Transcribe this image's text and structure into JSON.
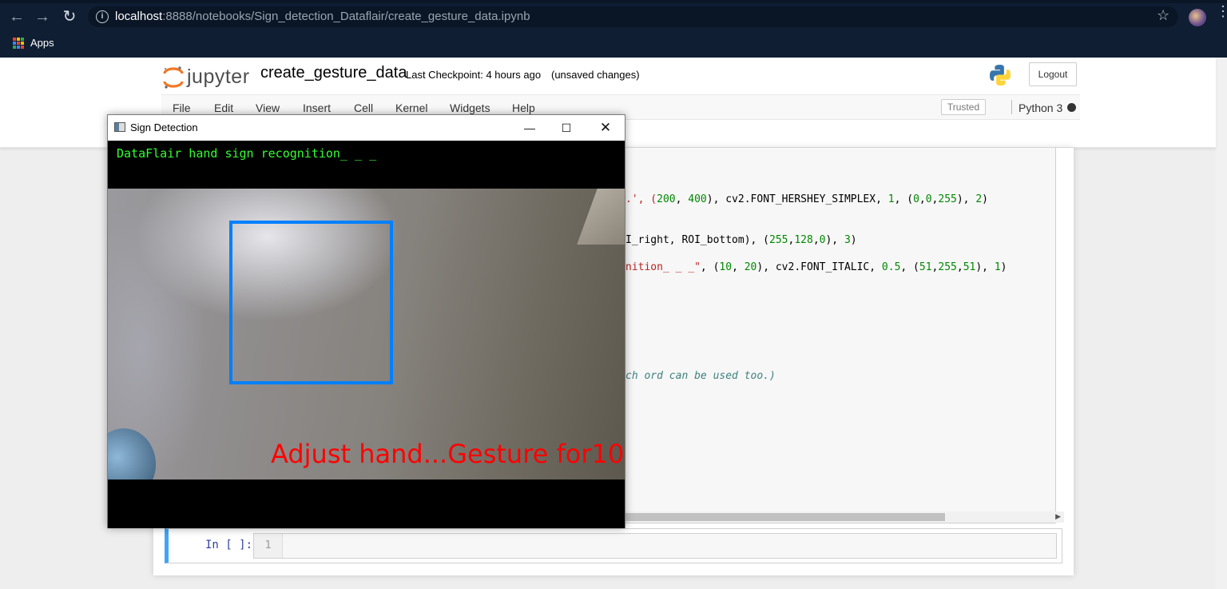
{
  "browser": {
    "url_host": "localhost",
    "url_path": ":8888/notebooks/Sign_detection_Dataflair/create_gesture_data.ipynb",
    "bookmarks_label": "Apps"
  },
  "jupyter": {
    "logo_text": "jupyter",
    "notebook_title": "create_gesture_data",
    "checkpoint": "Last Checkpoint: 4 hours ago",
    "unsaved": "(unsaved changes)",
    "logout_label": "Logout",
    "menu": [
      "File",
      "Edit",
      "View",
      "Insert",
      "Cell",
      "Kernel",
      "Widgets",
      "Help"
    ],
    "trusted_label": "Trusted",
    "kernel_name": "Python 3"
  },
  "code_visible": {
    "line1_pre": ".', (",
    "line1_n1": "200",
    "line1_mid1": ", ",
    "line1_n2": "400",
    "line1_mid2": "), cv2.FONT_HERSHEY_SIMPLEX, ",
    "line1_n3": "1",
    "line1_mid3": ", (",
    "line1_n4": "0",
    "line1_mid4": ",",
    "line1_n5": "0",
    "line1_mid5": ",",
    "line1_n6": "255",
    "line1_mid6": "), ",
    "line1_n7": "2",
    "line1_end": ")",
    "line2_pre": "I_right, ROI_bottom), (",
    "line2_n1": "255",
    "line2_mid1": ",",
    "line2_n2": "128",
    "line2_mid2": ",",
    "line2_n3": "0",
    "line2_mid3": "), ",
    "line2_n4": "3",
    "line2_end": ")",
    "line3_str": "nition_ _ _\"",
    "line3_mid0": ", (",
    "line3_n1": "10",
    "line3_mid1": ", ",
    "line3_n2": "20",
    "line3_mid2": "), cv2.FONT_ITALIC, ",
    "line3_n3": "0.5",
    "line3_mid3": ", (",
    "line3_n4": "51",
    "line3_mid4": ",",
    "line3_n5": "255",
    "line3_mid5": ",",
    "line3_n6": "51",
    "line3_mid6": "), ",
    "line3_n7": "1",
    "line3_end": ")",
    "line4_comment": "ch ord can be used too.)"
  },
  "empty_cell": {
    "prompt": "In [ ]:",
    "line_number": "1"
  },
  "sign_window": {
    "title": "Sign Detection",
    "header_text": "DataFlair hand sign recognition_ _ _",
    "overlay_text": "Adjust hand...Gesture for10"
  },
  "colors": {
    "browser_bg": "#0f1e33",
    "roi_box": "#0080ff",
    "overlay_text": "#ff0000",
    "header_text": "#33ff33",
    "cell_selected_border": "#42a5f5"
  }
}
